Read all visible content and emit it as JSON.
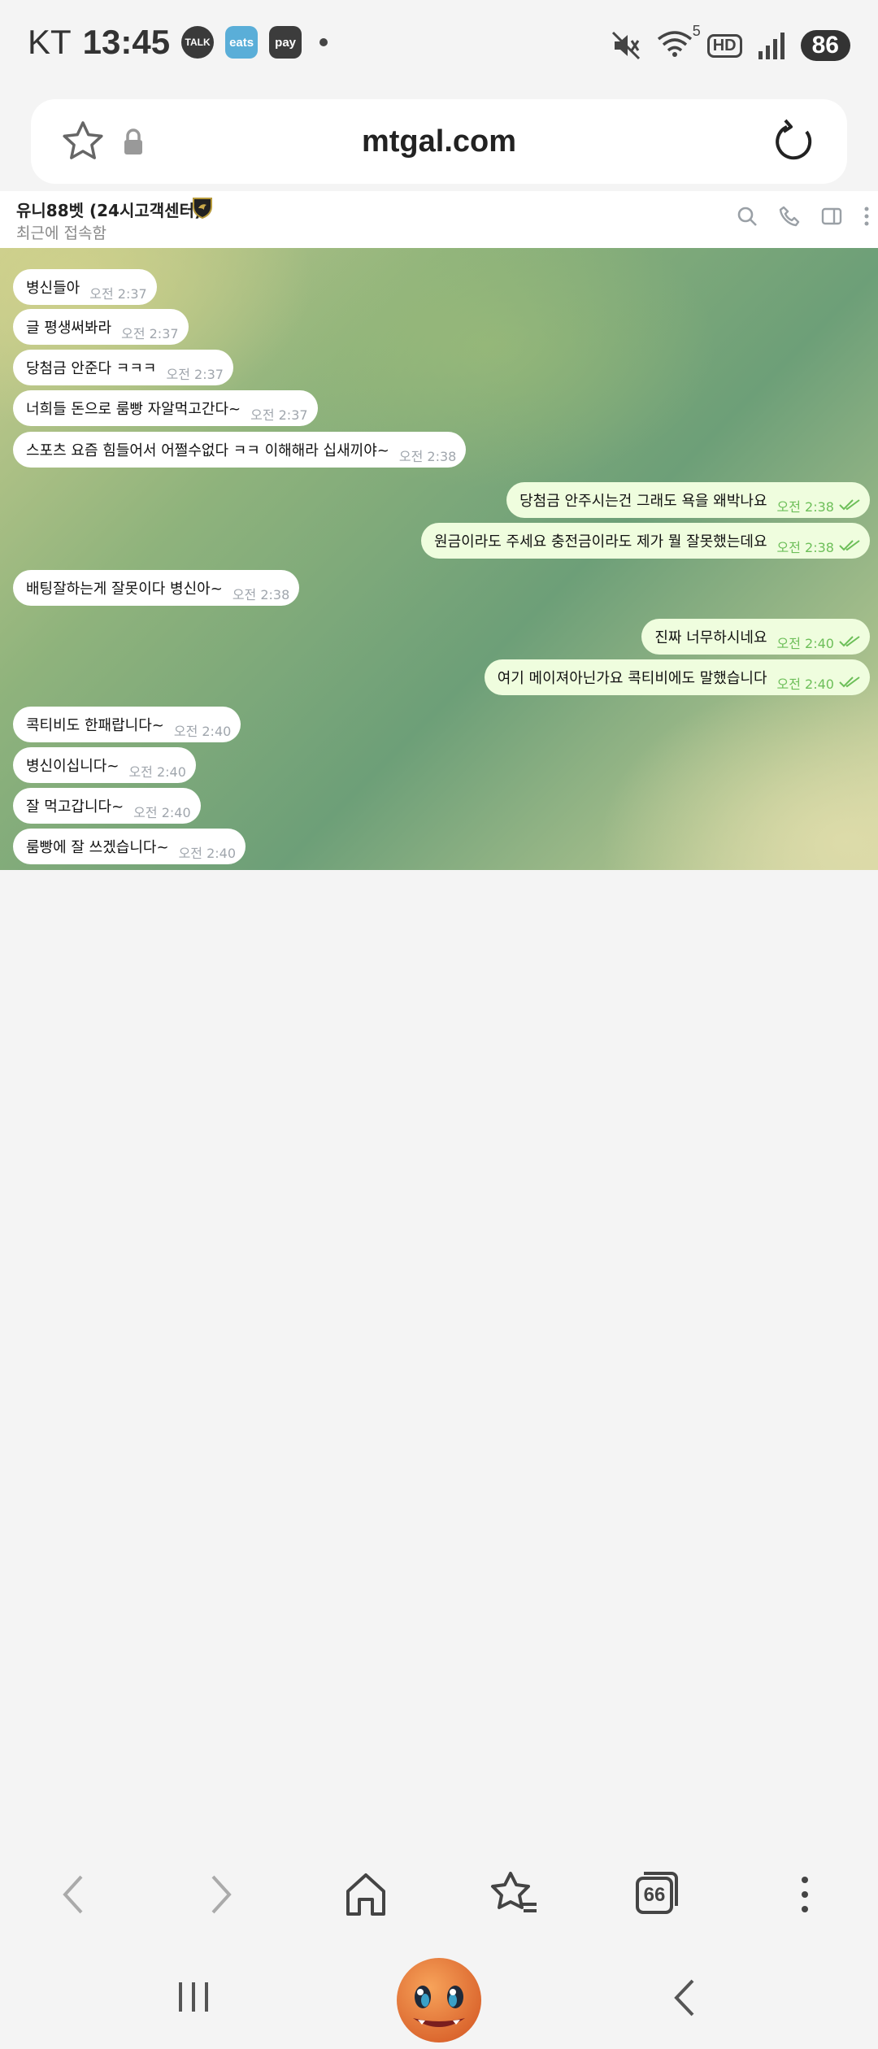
{
  "status_bar": {
    "carrier": "KT",
    "time": "13:45",
    "apps": [
      "TALK",
      "eats",
      "pay"
    ],
    "hd_label": "HD",
    "wifi_label": "5",
    "battery": "86"
  },
  "browser": {
    "url": "mtgal.com"
  },
  "chat": {
    "title": "유니88벳 (24시고객센터)",
    "subtitle": "최근에 접속함",
    "messages": [
      {
        "dir": "in",
        "text": "병신들아",
        "time": "오전 2:37"
      },
      {
        "dir": "in",
        "text": "글 평생써봐라",
        "time": "오전 2:37"
      },
      {
        "dir": "in",
        "text": "당첨금 안준다 ㅋㅋㅋ",
        "time": "오전 2:37"
      },
      {
        "dir": "in",
        "text": "너희들 돈으로 룸빵 자알먹고간다~",
        "time": "오전 2:37"
      },
      {
        "dir": "in",
        "text": "스포츠 요즘 힘들어서 어쩔수없다 ㅋㅋ 이해해라 십새끼야~",
        "time": "오전 2:38"
      },
      {
        "dir": "out",
        "text": "당첨금 안주시는건 그래도 욕을 왜박나요",
        "time": "오전 2:38"
      },
      {
        "dir": "out",
        "text": "원금이라도 주세요 충전금이라도 제가 뭘 잘못했는데요",
        "time": "오전 2:38"
      },
      {
        "dir": "in",
        "text": "배팅잘하는게 잘못이다 병신아~",
        "time": "오전 2:38"
      },
      {
        "dir": "out",
        "text": "진짜 너무하시네요",
        "time": "오전 2:40"
      },
      {
        "dir": "out",
        "text": "여기 메이져아닌가요 콕티비에도 말했습니다",
        "time": "오전 2:40"
      },
      {
        "dir": "in",
        "text": "콕티비도 한패랍니다~",
        "time": "오전 2:40"
      },
      {
        "dir": "in",
        "text": "병신이십니다~",
        "time": "오전 2:40"
      },
      {
        "dir": "in",
        "text": "잘 먹고갑니다~",
        "time": "오전 2:40"
      },
      {
        "dir": "in",
        "text": "룸빵에 잘 쓰겠습니다~",
        "time": "오전 2:40"
      }
    ]
  },
  "browser_toolbar": {
    "tabs_count": "66"
  },
  "colors": {
    "incoming_bubble": "#ffffff",
    "outgoing_bubble": "#effdde",
    "read_ticks": "#6dbf59"
  }
}
